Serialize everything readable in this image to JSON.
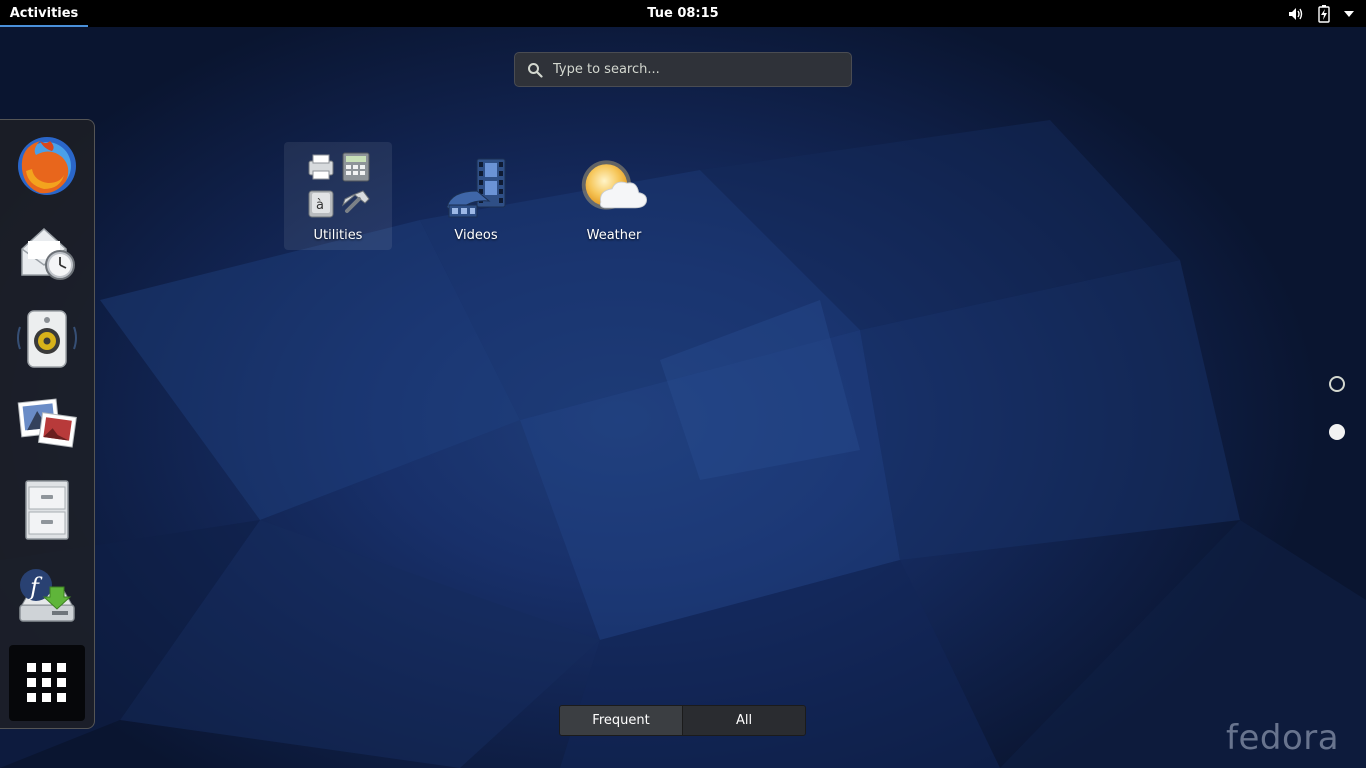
{
  "topbar": {
    "activities_label": "Activities",
    "clock": "Tue 08:15",
    "tray_icons": [
      "volume-icon",
      "battery-icon",
      "system-menu-arrow-icon"
    ]
  },
  "search": {
    "placeholder": "Type to search..."
  },
  "dash": {
    "items": [
      {
        "name": "firefox",
        "icon": "firefox-icon"
      },
      {
        "name": "evolution",
        "icon": "mail-clock-icon"
      },
      {
        "name": "rhythmbox",
        "icon": "speaker-icon"
      },
      {
        "name": "shotwell",
        "icon": "photos-icon"
      },
      {
        "name": "files",
        "icon": "file-cabinet-icon"
      },
      {
        "name": "install-fedora",
        "icon": "fedora-install-icon"
      }
    ],
    "show_apps_icon": "grid-icon"
  },
  "apps": [
    {
      "label": "Utilities",
      "icon": "utilities-folder-icon",
      "selected": true
    },
    {
      "label": "Videos",
      "icon": "film-reel-icon",
      "selected": false
    },
    {
      "label": "Weather",
      "icon": "weather-sun-cloud-icon",
      "selected": false
    }
  ],
  "pages": {
    "count": 2,
    "current": 2
  },
  "view_switcher": {
    "frequent_label": "Frequent",
    "all_label": "All",
    "active": "Frequent"
  },
  "branding": {
    "logo_text": "fedora"
  },
  "colors": {
    "accent": "#4a90d9",
    "topbar": "#000000",
    "background": "#18306a"
  }
}
